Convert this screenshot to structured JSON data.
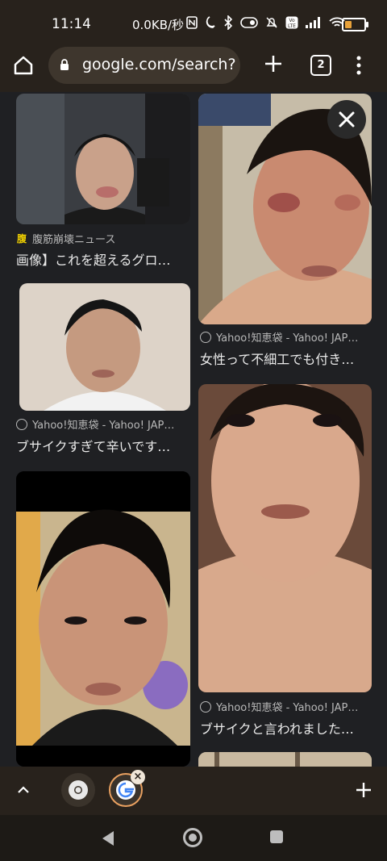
{
  "status_bar": {
    "time": "11:14",
    "net_speed": "0.0KB/秒",
    "battery_level": 0.35,
    "icons": [
      "nfc-icon",
      "moon-icon",
      "bluetooth-icon",
      "vibrate-icon",
      "mute-icon",
      "volte-icon",
      "signal-icon",
      "wifi-icon",
      "battery-icon"
    ]
  },
  "toolbar": {
    "url": "google.com/search?c",
    "tab_count": "2"
  },
  "results": [
    {
      "source": "腹筋崩壊ニュース",
      "favicon": "腹",
      "title": "画像】これを超えるグロ…"
    },
    {
      "source": "Yahoo!知恵袋 - Yahoo! JAP…",
      "title": "女性って不細工でも付き…"
    },
    {
      "source": "Yahoo!知恵袋 - Yahoo! JAP…",
      "title": "ブサイクすぎて辛いです…"
    },
    {
      "source": "Yahoo!知恵袋 - Yahoo! JAP…",
      "title": "ブサイクと言われました…"
    }
  ],
  "colors": {
    "chrome_bar": "#28221c",
    "content_bg": "#1f2023",
    "active_tab_ring": "#e8a060",
    "favicon_yellow": "#f0d000"
  }
}
